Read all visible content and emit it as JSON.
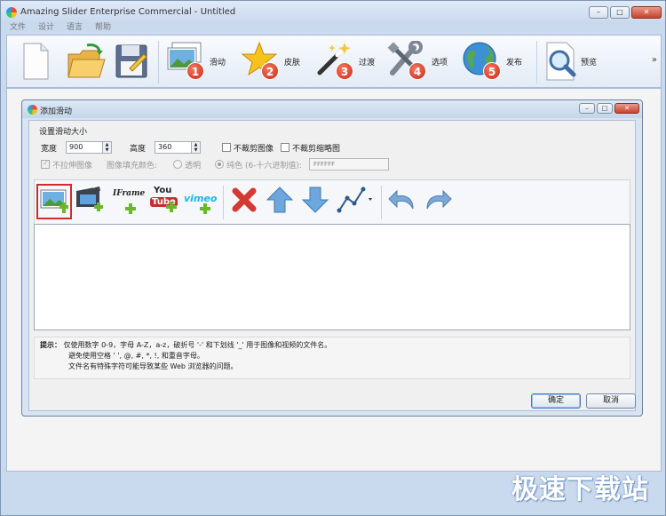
{
  "window": {
    "title": "Amazing Slider Enterprise Commercial - Untitled",
    "controls": {
      "minimize": "–",
      "maximize": "□",
      "close": "✕"
    }
  },
  "menu": [
    "文件",
    "设计",
    "语言",
    "帮助"
  ],
  "toolbar": {
    "buttons": [
      {
        "icon": "new-file-icon",
        "label": ""
      },
      {
        "icon": "open-folder-icon",
        "label": ""
      },
      {
        "icon": "save-disk-icon",
        "label": ""
      },
      {
        "icon": "slides-icon",
        "label": "滑动",
        "badge": "1"
      },
      {
        "icon": "skin-star-icon",
        "label": "皮肤",
        "badge": "2"
      },
      {
        "icon": "transition-wand-icon",
        "label": "过渡",
        "badge": "3"
      },
      {
        "icon": "options-tools-icon",
        "label": "选项",
        "badge": "4"
      },
      {
        "icon": "publish-globe-icon",
        "label": "发布",
        "badge": "5"
      },
      {
        "icon": "preview-magnifier-icon",
        "label": "预览"
      }
    ],
    "more": "»"
  },
  "dialog": {
    "title": "添加滑动",
    "section_label": "设置滑动大小",
    "width_label": "宽度",
    "width_value": "900",
    "height_label": "高度",
    "height_value": "360",
    "no_crop_image": "不裁剪图像",
    "no_crop_thumb": "不裁剪缩略图",
    "no_stretch": "不拉伸图像",
    "fill_color_label": "图像填充颜色:",
    "transparent": "透明",
    "solid_color": "纯色 (6-十六进制值):",
    "color_value": "FFFFFF",
    "iframe_text": "IFrame",
    "youtube_you": "You",
    "youtube_tube": "Tube",
    "vimeo_text": "vimeo",
    "tip_label": "提示：",
    "tip_line1": "仅使用数字 0-9，字母 A-Z，a-z，破折号 '-' 和下划线 '_' 用于图像和视频的文件名。",
    "tip_line2": "避免使用空格 ' ', @, #, *, !, 和重音字母。",
    "tip_line3": "文件名有特殊字符可能导致某些 Web 浏览器的问题。",
    "ok": "确定",
    "cancel": "取消"
  },
  "watermark": "极速下载站",
  "colors": {
    "accent": "#3b79c8",
    "selected_border": "#d12c2c",
    "badge": "#d6351f"
  }
}
